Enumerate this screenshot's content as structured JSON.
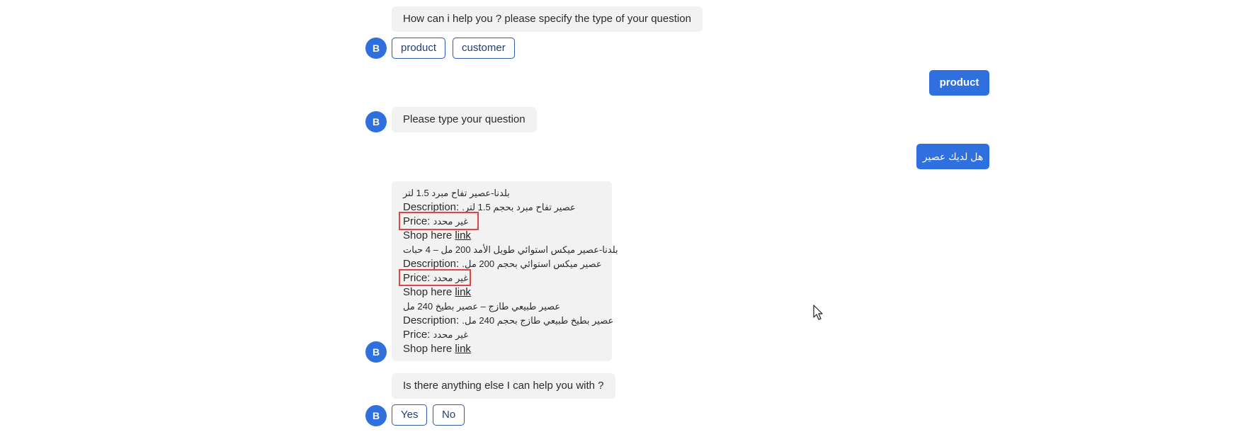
{
  "bot_avatar": "B",
  "messages": {
    "greeting": "How can i help you ? please specify the type of your question",
    "type_options": [
      "product",
      "customer"
    ],
    "user_choice": "product",
    "prompt": "Please type your question",
    "user_question": "هل لديك عصير",
    "products": [
      {
        "name": "بلدنا-عصير تفاح مبرد 1.5 لتر",
        "description_label": "Description:",
        "description": "عصير تفاح مبرد بحجم 1.5 لتر.",
        "price_label": "Price:",
        "price": "غير محدد",
        "shop_label": "Shop here",
        "link_text": "link"
      },
      {
        "name": "بلدنا-عصير ميكس استوائي طويل الأمد 200 مل – 4 حبات",
        "description_label": "Description:",
        "description": "عصير ميكس استوائي بحجم 200 مل.",
        "price_label": "Price:",
        "price": "غير محدد",
        "shop_label": "Shop here",
        "link_text": "link"
      },
      {
        "name": "عصير طبيعي طازج – عصير بطيخ 240 مل",
        "description_label": "Description:",
        "description": "عصير بطيخ طبيعي طازج بحجم 240 مل.",
        "price_label": "Price:",
        "price": "غير محدد",
        "shop_label": "Shop here",
        "link_text": "link"
      }
    ],
    "followup": "Is there anything else I can help you with ?",
    "followup_options": [
      "Yes",
      "No"
    ]
  },
  "colors": {
    "accent": "#2f6fde",
    "bubble_bg": "#f2f2f2",
    "highlight": "#e04444"
  }
}
